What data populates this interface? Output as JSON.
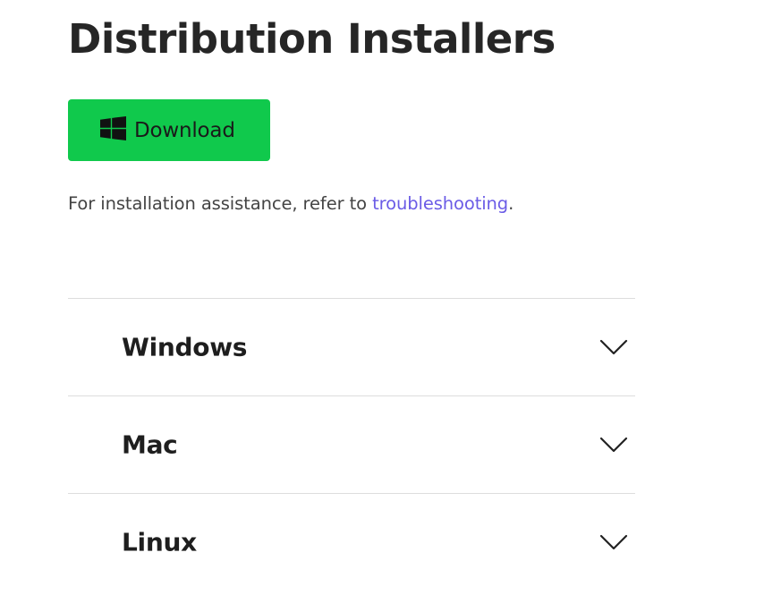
{
  "page": {
    "title": "Distribution Installers"
  },
  "download_button": {
    "icon": "windows-logo-icon",
    "label": "Download",
    "color": "#10c94c"
  },
  "help": {
    "prefix": "For installation assistance, refer to ",
    "link_text": "troubleshooting",
    "suffix": ".",
    "link_color": "#6b5ce6"
  },
  "accordion": {
    "items": [
      {
        "label": "Windows",
        "icon": "chevron-down-icon"
      },
      {
        "label": "Mac",
        "icon": "chevron-down-icon"
      },
      {
        "label": "Linux",
        "icon": "chevron-down-icon"
      }
    ]
  }
}
